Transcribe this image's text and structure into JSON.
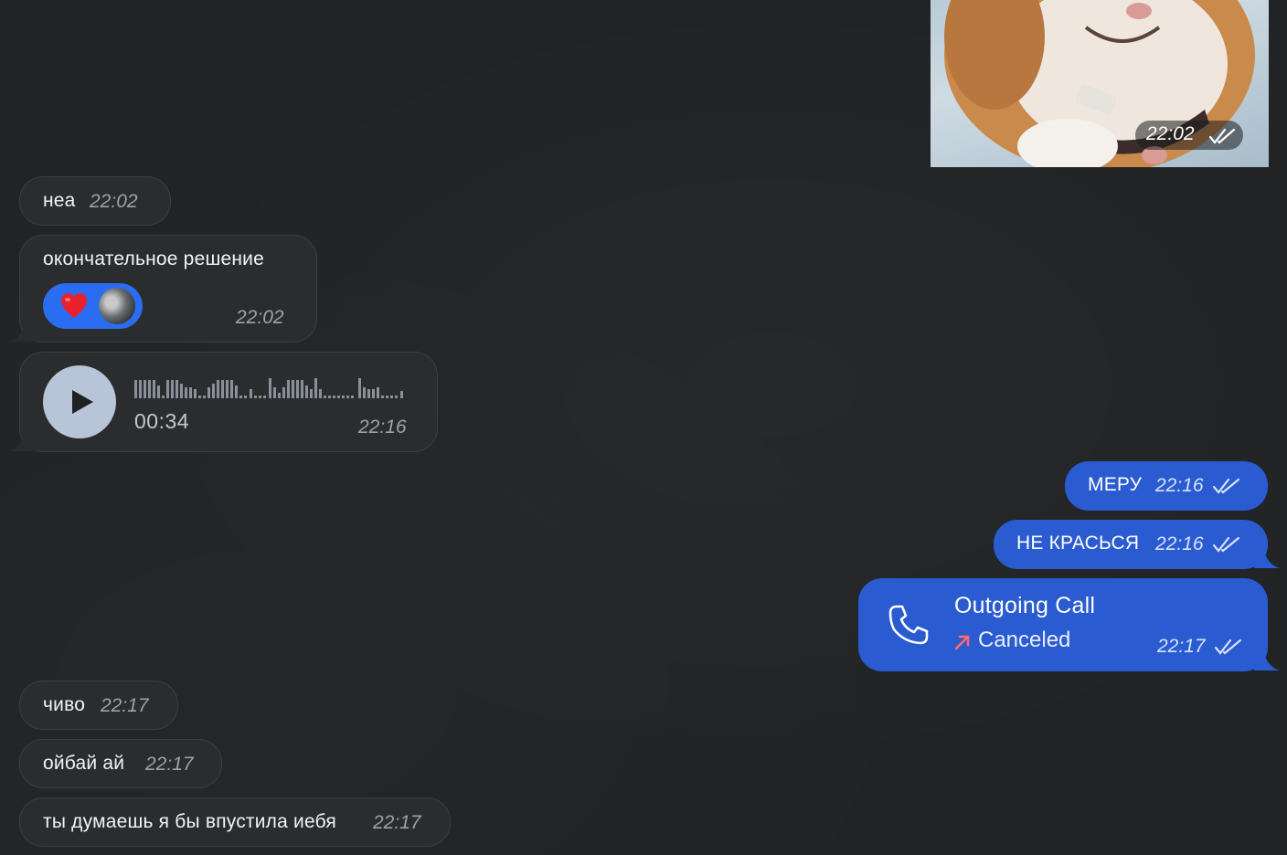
{
  "photo_message": {
    "time": "22:02"
  },
  "incoming": [
    {
      "text": "неа",
      "time": "22:02"
    },
    {
      "text": "окончательное решение",
      "time": "22:02",
      "reaction": "heart"
    },
    {
      "type": "voice",
      "duration": "00:34",
      "time": "22:16"
    },
    {
      "text": "чиво",
      "time": "22:17"
    },
    {
      "text": "ойбай ай",
      "time": "22:17"
    },
    {
      "text": "ты думаешь я бы впустила иебя",
      "time": "22:17"
    }
  ],
  "outgoing": [
    {
      "text": "МЕРУ",
      "time": "22:16"
    },
    {
      "text": "НЕ КРАСЬСЯ",
      "time": "22:16"
    },
    {
      "type": "call",
      "title": "Outgoing Call",
      "status": "Canceled",
      "time": "22:17"
    }
  ],
  "colors": {
    "background": "#212325",
    "incoming_bubble": "#2b2c2e",
    "outgoing_bubble": "#2a5bd0",
    "reaction_pill": "#2a6df0",
    "canceled_arrow": "#ff6b6b"
  },
  "icons": {
    "read_receipt": "double-check-icon",
    "play": "play-icon",
    "phone": "phone-icon",
    "reaction": "heart-icon",
    "call_direction": "arrow-up-right-icon"
  }
}
